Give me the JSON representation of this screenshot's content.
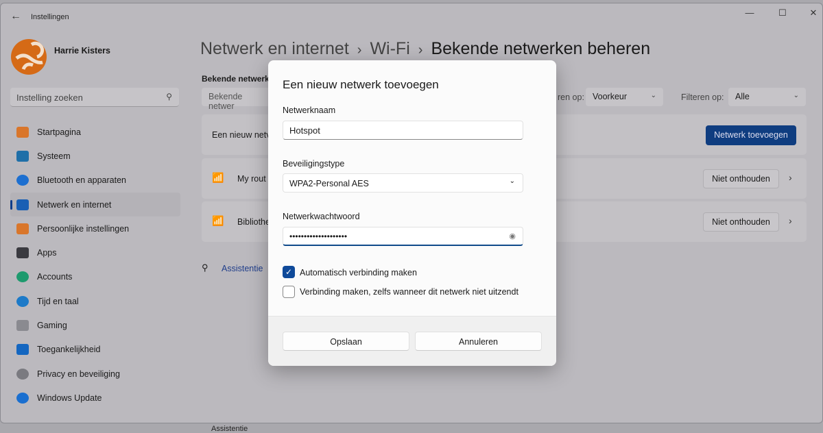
{
  "window": {
    "title": "Instellingen",
    "back_icon": "arrow-left-icon",
    "controls": [
      "minimize",
      "maximize",
      "close"
    ]
  },
  "user": {
    "name": "Harrie Kisters"
  },
  "search": {
    "placeholder": "Instelling zoeken"
  },
  "sidebar": {
    "items": [
      {
        "label": "Startpagina",
        "icon": "home-icon",
        "color": "#d9762b"
      },
      {
        "label": "Systeem",
        "icon": "monitor-icon",
        "color": "#1f6fa8"
      },
      {
        "label": "Bluetooth en apparaten",
        "icon": "bluetooth-icon",
        "color": "#1d6fd0"
      },
      {
        "label": "Netwerk en internet",
        "icon": "wifi-icon",
        "color": "#1a5fb4",
        "selected": true
      },
      {
        "label": "Persoonlijke instellingen",
        "icon": "brush-icon",
        "color": "#d9762b"
      },
      {
        "label": "Apps",
        "icon": "apps-icon",
        "color": "#3a3a40"
      },
      {
        "label": "Accounts",
        "icon": "person-icon",
        "color": "#1e9a6e"
      },
      {
        "label": "Tijd en taal",
        "icon": "globe-clock-icon",
        "color": "#1d7ac8"
      },
      {
        "label": "Gaming",
        "icon": "gamepad-icon",
        "color": "#8a8a90"
      },
      {
        "label": "Toegankelijkheid",
        "icon": "accessibility-icon",
        "color": "#1466c0"
      },
      {
        "label": "Privacy en beveiliging",
        "icon": "shield-icon",
        "color": "#7a7a80"
      },
      {
        "label": "Windows Update",
        "icon": "update-icon",
        "color": "#1a6fd0"
      }
    ]
  },
  "breadcrumb": [
    "Netwerk en internet",
    "Wi-Fi",
    "Bekende netwerken beheren"
  ],
  "main": {
    "section_title": "Bekende netwerk",
    "search_placeholder": "Bekende netwer",
    "sort_label": "ren op:",
    "sort_value": "Voorkeur",
    "filter_label": "Filteren op:",
    "filter_value": "Alle",
    "add_row_text": "Een nieuw netv",
    "add_button": "Netwerk toevoegen",
    "networks": [
      {
        "name": "My rout",
        "forget": "Niet onthouden"
      },
      {
        "name": "Bibliothe",
        "forget": "Niet onthouden"
      }
    ],
    "help": "Assistentie"
  },
  "dialog": {
    "title": "Een nieuw netwerk toevoegen",
    "name_label": "Netwerknaam",
    "name_value": "Hotspot",
    "security_label": "Beveiligingstype",
    "security_value": "WPA2-Personal AES",
    "password_label": "Netwerkwachtwoord",
    "password_value": "••••••••••••••••••••",
    "auto_connect": {
      "label": "Automatisch verbinding maken",
      "checked": true
    },
    "hidden_connect": {
      "label": "Verbinding maken, zelfs wanneer dit netwerk niet uitzendt",
      "checked": false
    },
    "save": "Opslaan",
    "cancel": "Annuleren",
    "accent": "#0f4a9a"
  }
}
